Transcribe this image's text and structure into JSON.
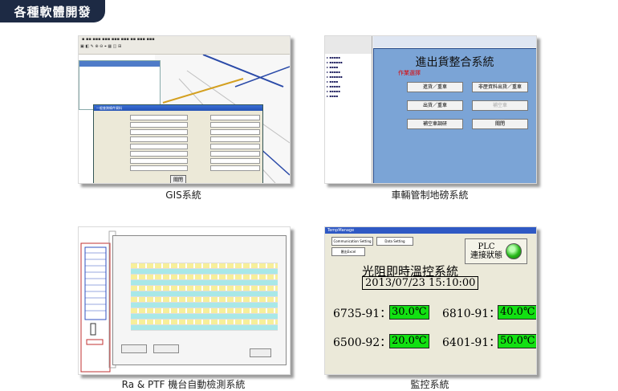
{
  "header": {
    "title": "各種軟體開發"
  },
  "cards": [
    {
      "caption": "GIS系統"
    },
    {
      "caption": "車輛管制地磅系統"
    },
    {
      "caption": "Ra & PTF 機台自動檢測系統"
    },
    {
      "caption": "監控系統"
    }
  ],
  "truck_app": {
    "title": "進出貨整合系統",
    "section": "作業選擇",
    "buttons": [
      {
        "label": "進貨／重車",
        "enabled": true
      },
      {
        "label": "非歷資料出貨／重車",
        "enabled": true
      },
      {
        "label": "出貨／重車",
        "enabled": true
      },
      {
        "label": "補空車",
        "enabled": false
      },
      {
        "label": "補空車調研",
        "enabled": true
      },
      {
        "label": "關閉",
        "enabled": true
      }
    ]
  },
  "gis_app": {
    "dialog_title": "一般查詢條件資料",
    "close_label": "關閉"
  },
  "monitor_app": {
    "window_title": "TempManage",
    "buttons": [
      "Communication Setting",
      "Data Setting",
      "匯出Excel"
    ],
    "plc_label_line1": "PLC",
    "plc_label_line2": "連接狀態",
    "title": "光阻即時溫控系統",
    "datetime": "2013/07/23 15:10:00",
    "readings": [
      {
        "id": "6735-91",
        "value": "30.0℃"
      },
      {
        "id": "6810-91",
        "value": "40.0℃"
      },
      {
        "id": "6500-92",
        "value": "20.0℃"
      },
      {
        "id": "6401-91",
        "value": "50.0℃"
      }
    ],
    "value_color": "#12e012"
  }
}
